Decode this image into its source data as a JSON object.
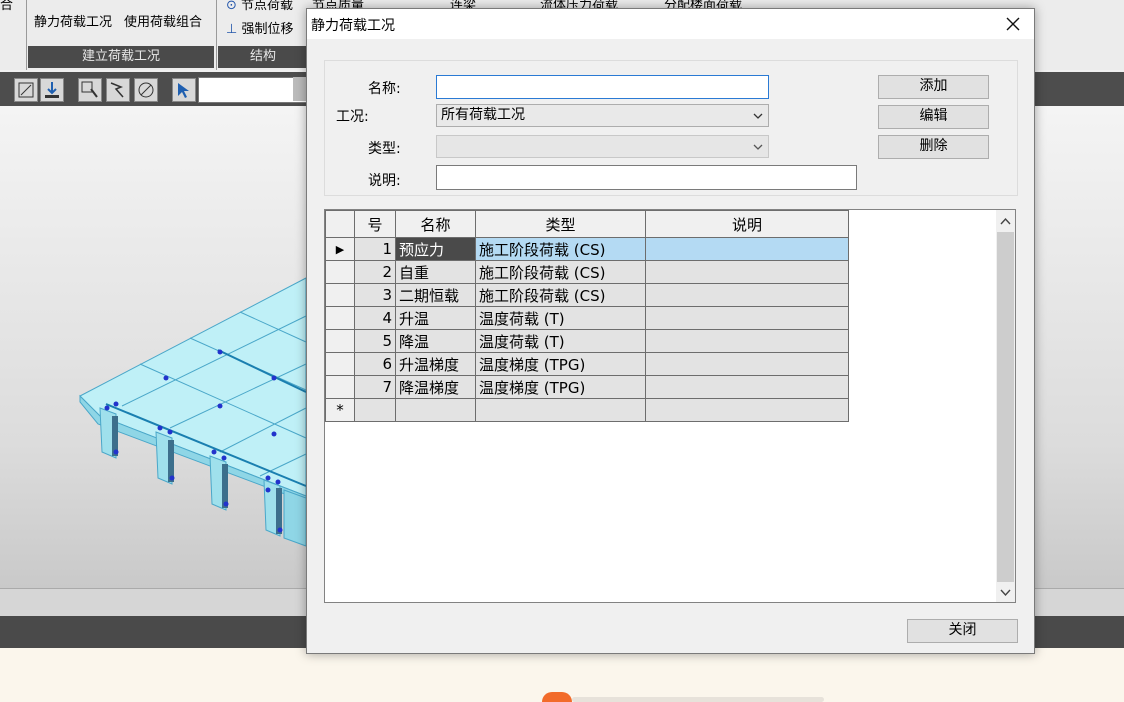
{
  "app": {
    "ribbon": {
      "partial_left": "合",
      "static_load_cases": "静力荷载工况",
      "use_load_combo": "使用荷载组合",
      "group_label_left": "建立荷载工况",
      "nodal_load": "节点荷载",
      "nodal_mass": "节点质量",
      "forced_disp": "强制位移",
      "group_label_right": "结构",
      "partial_a": "连梁",
      "partial_b": "流体压力荷载",
      "partial_c": "分配楼面荷载"
    }
  },
  "dialog": {
    "title": "静力荷载工况",
    "form": {
      "name_label": "名称:",
      "name_value": "",
      "case_label": "工况:",
      "case_value": "所有荷载工况",
      "type_label": "类型:",
      "type_value": "",
      "desc_label": "说明:",
      "desc_value": ""
    },
    "buttons": {
      "add": "添加",
      "edit": "编辑",
      "delete": "删除",
      "close": "关闭"
    },
    "table": {
      "headers": [
        "号",
        "名称",
        "类型",
        "说明"
      ],
      "rows": [
        {
          "num": "1",
          "name": "预应力",
          "type": "施工阶段荷载 (CS)",
          "desc": ""
        },
        {
          "num": "2",
          "name": "自重",
          "type": "施工阶段荷载 (CS)",
          "desc": ""
        },
        {
          "num": "3",
          "name": "二期恒载",
          "type": "施工阶段荷载 (CS)",
          "desc": ""
        },
        {
          "num": "4",
          "name": "升温",
          "type": "温度荷载 (T)",
          "desc": ""
        },
        {
          "num": "5",
          "name": "降温",
          "type": "温度荷载 (T)",
          "desc": ""
        },
        {
          "num": "6",
          "name": "升温梯度",
          "type": "温度梯度 (TPG)",
          "desc": ""
        },
        {
          "num": "7",
          "name": "降温梯度",
          "type": "温度梯度 (TPG)",
          "desc": ""
        }
      ],
      "current_row_marker": "▶",
      "new_row_marker": "*"
    }
  },
  "colors": {
    "selection": "#b4daf3",
    "active_cell": "#4a4a4a",
    "ribbon_label_bg": "#4a4a4a",
    "model_fill": "#bff0f7",
    "node_dot": "#2233cc"
  }
}
